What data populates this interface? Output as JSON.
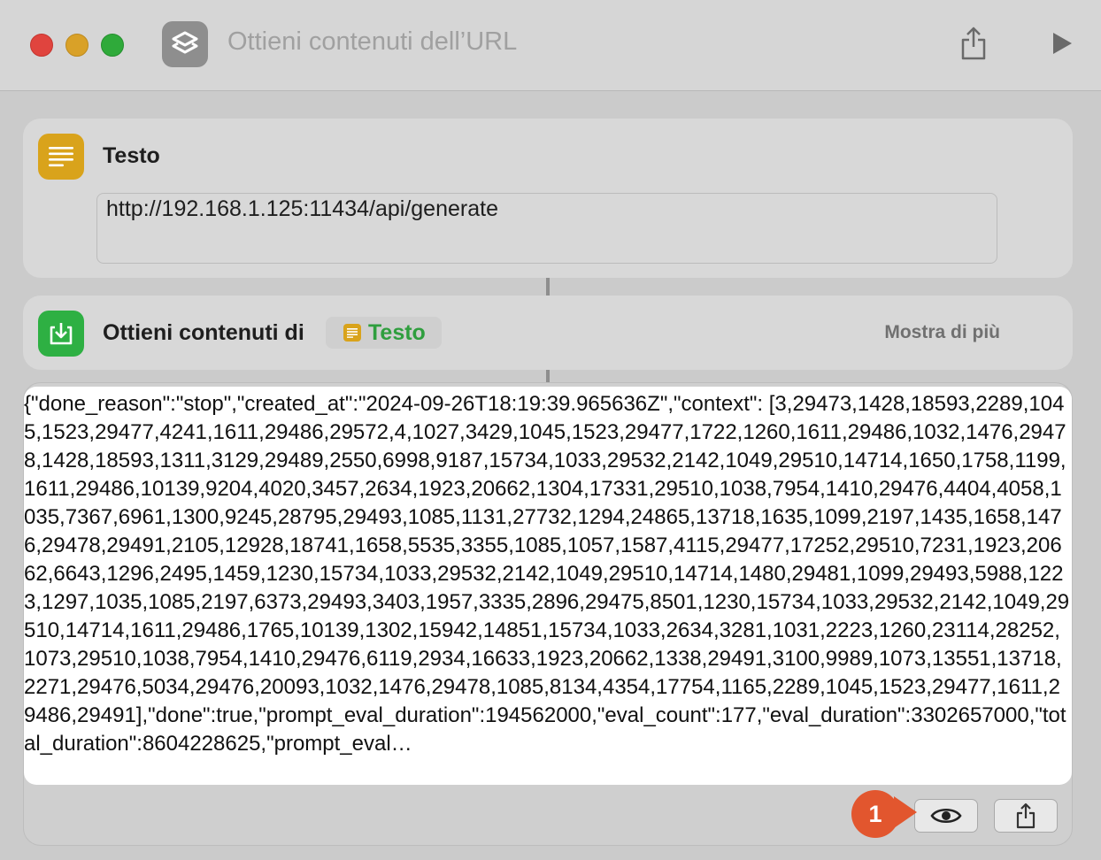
{
  "window": {
    "title": "Ottieni contenuti dell’URL",
    "icons": {
      "app": "shortcuts-icon",
      "share": "share-icon",
      "run": "play-icon"
    }
  },
  "text_action": {
    "title": "Testo",
    "icon": "text-lines-icon",
    "value": "http://192.168.1.125:11434/api/generate"
  },
  "get_contents_action": {
    "title": "Ottieni contenuti di",
    "icon": "download-tray-icon",
    "token_label": "Testo",
    "show_more": "Mostra di più"
  },
  "result": {
    "text": "{\"done_reason\":\"stop\",\"created_at\":\"2024-09-26T18:19:39.965636Z\",\"context\": [3,29473,1428,18593,2289,1045,1523,29477,4241,1611,29486,29572,4,1027,3429,1045,1523,29477,1722,1260,1611,29486,1032,1476,29478,1428,18593,1311,3129,29489,2550,6998,9187,15734,1033,29532,2142,1049,29510,14714,1650,1758,1199,1611,29486,10139,9204,4020,3457,2634,1923,20662,1304,17331,29510,1038,7954,1410,29476,4404,4058,1035,7367,6961,1300,9245,28795,29493,1085,1131,27732,1294,24865,13718,1635,1099,2197,1435,1658,1476,29478,29491,2105,12928,18741,1658,5535,3355,1085,1057,1587,4115,29477,17252,29510,7231,1923,20662,6643,1296,2495,1459,1230,15734,1033,29532,2142,1049,29510,14714,1480,29481,1099,29493,5988,1223,1297,1035,1085,2197,6373,29493,3403,1957,3335,2896,29475,8501,1230,15734,1033,29532,2142,1049,29510,14714,1611,29486,1765,10139,1302,15942,14851,15734,1033,2634,3281,1031,2223,1260,23114,28252,1073,29510,1038,7954,1410,29476,6119,2934,16633,1923,20662,1338,29491,3100,9989,1073,13551,13718,2271,29476,5034,29476,20093,1032,1476,29478,1085,8134,4354,17754,1165,2289,1045,1523,29477,1611,29486,29491],\"done\":true,\"prompt_eval_duration\":194562000,\"eval_count\":177,\"eval_duration\":3302657000,\"total_duration\":8604228625,\"prompt_eval…",
    "icons": {
      "preview": "eye-icon",
      "share": "share-icon"
    }
  },
  "annotation": {
    "badge": "1",
    "color": "#e2562e"
  }
}
